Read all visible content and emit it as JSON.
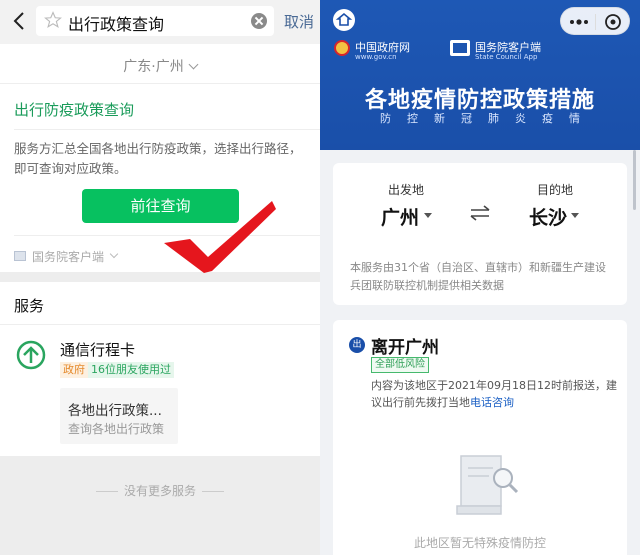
{
  "left": {
    "search": {
      "query": "出行政策查询",
      "cancel_label": "取消"
    },
    "location": {
      "text": "广东·广州"
    },
    "policy": {
      "title": "出行防疫政策查询",
      "description": "服务方汇总全国各地出行防疫政策，选择出行路径，即可查询对应政策。",
      "button_label": "前往查询",
      "source": "国务院客户端"
    },
    "services": {
      "header": "服务",
      "app": {
        "name": "通信行程卡",
        "tag_gov": "政府",
        "tag_friends": "16位朋友使用过",
        "sub_title": "各地出行政策...",
        "sub_desc": "查询各地出行政策"
      },
      "no_more": "没有更多服务"
    }
  },
  "right": {
    "banner": {
      "gov_name": "中国政府网",
      "gov_url": "www.gov.cn",
      "sc_name": "国务院客户端",
      "sc_en": "State Council App",
      "title": "各地疫情防控政策措施",
      "subtitle_chars": [
        "防",
        "控",
        "新",
        "冠",
        "肺",
        "炎",
        "疫",
        "情"
      ]
    },
    "route": {
      "from_label": "出发地",
      "from_city": "广州",
      "to_label": "目的地",
      "to_city": "长沙",
      "description": "本服务由31个省（自治区、直辖市）和新疆生产建设兵团联防联控机制提供相关数据"
    },
    "leave": {
      "badge": "出",
      "title": "离开广州",
      "risk_tag": "全部低风险",
      "desc_before": "内容为该地区于2021年09月18日12时前报送，建议出行前先拨打当地",
      "desc_link": "电话咨询",
      "empty_text": "此地区暂无特殊疫情防控"
    }
  },
  "colors": {
    "wechat_green": "#07c160",
    "title_green": "#1a9b5a",
    "banner_blue": "#1a4fa9",
    "checkmark_red": "#e5161d"
  }
}
